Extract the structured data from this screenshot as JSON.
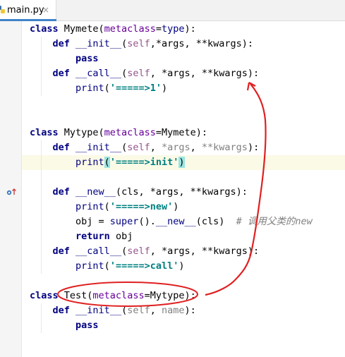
{
  "tab": {
    "filename": "main.py",
    "close": "×",
    "icon": "python-file-icon"
  },
  "code_lines": [
    {
      "parts": [
        [
          "kw",
          "class"
        ],
        [
          "",
          ""
        ],
        [
          "",
          " Mymete("
        ],
        [
          "kwarg",
          "metaclass"
        ],
        [
          "",
          "="
        ],
        [
          "bi",
          "type"
        ],
        [
          "",
          "):"
        ]
      ]
    },
    {
      "parts": [
        [
          "",
          "    "
        ],
        [
          "kw",
          "def"
        ],
        [
          "",
          " "
        ],
        [
          "bi",
          "__init__"
        ],
        [
          "",
          "("
        ],
        [
          "sf",
          "self"
        ],
        [
          "",
          ",*args, **kwargs):"
        ]
      ]
    },
    {
      "parts": [
        [
          "",
          "        "
        ],
        [
          "kw",
          "pass"
        ]
      ]
    },
    {
      "parts": [
        [
          "",
          "    "
        ],
        [
          "kw",
          "def"
        ],
        [
          "",
          " "
        ],
        [
          "bi",
          "__call__"
        ],
        [
          "",
          "("
        ],
        [
          "sf",
          "self"
        ],
        [
          "",
          ", *args, **kwargs):"
        ]
      ]
    },
    {
      "parts": [
        [
          "",
          "        "
        ],
        [
          "bi",
          "print"
        ],
        [
          "",
          "("
        ],
        [
          "st",
          "'=====>1'"
        ],
        [
          "",
          ")"
        ]
      ]
    },
    {
      "parts": []
    },
    {
      "parts": []
    },
    {
      "parts": [
        [
          "kw",
          "class"
        ],
        [
          "",
          " Mytype("
        ],
        [
          "kwarg",
          "metaclass"
        ],
        [
          "",
          "=Mymete):"
        ]
      ]
    },
    {
      "parts": [
        [
          "",
          "    "
        ],
        [
          "kw",
          "def"
        ],
        [
          "",
          " "
        ],
        [
          "bi",
          "__init__"
        ],
        [
          "",
          "("
        ],
        [
          "sf",
          "self"
        ],
        [
          "",
          ", "
        ],
        [
          "unused",
          "*args"
        ],
        [
          "",
          ", "
        ],
        [
          "unused",
          "**kwargs"
        ],
        [
          "",
          "):"
        ]
      ]
    },
    {
      "parts": [
        [
          "",
          "        "
        ],
        [
          "bi",
          "print"
        ],
        [
          "bm",
          "("
        ],
        [
          "st",
          "'=====>init'"
        ],
        [
          "bm",
          ")"
        ]
      ]
    },
    {
      "parts": []
    },
    {
      "parts": [
        [
          "",
          "    "
        ],
        [
          "kw",
          "def"
        ],
        [
          "",
          " "
        ],
        [
          "bi",
          "__new__"
        ],
        [
          "",
          "(cls, *args, **kwargs):"
        ]
      ]
    },
    {
      "parts": [
        [
          "",
          "        "
        ],
        [
          "bi",
          "print"
        ],
        [
          "",
          "("
        ],
        [
          "st",
          "'=====>new'"
        ],
        [
          "",
          ")"
        ]
      ]
    },
    {
      "parts": [
        [
          "",
          "        obj = "
        ],
        [
          "bi",
          "super"
        ],
        [
          "",
          "()."
        ],
        [
          "bi",
          "__new__"
        ],
        [
          "",
          "(cls)  "
        ],
        [
          "cm",
          "# 调用父类的new"
        ]
      ]
    },
    {
      "parts": [
        [
          "",
          "        "
        ],
        [
          "kw",
          "return"
        ],
        [
          "",
          " obj"
        ]
      ]
    },
    {
      "parts": [
        [
          "",
          "    "
        ],
        [
          "kw",
          "def"
        ],
        [
          "",
          " "
        ],
        [
          "bi",
          "__call__"
        ],
        [
          "",
          "("
        ],
        [
          "sf",
          "self"
        ],
        [
          "",
          ", *args, **kwargs):"
        ]
      ]
    },
    {
      "parts": [
        [
          "",
          "        "
        ],
        [
          "bi",
          "print"
        ],
        [
          "",
          "("
        ],
        [
          "st",
          "'=====>call'"
        ],
        [
          "",
          ")"
        ]
      ]
    },
    {
      "parts": []
    },
    {
      "parts": [
        [
          "kw",
          "class"
        ],
        [
          "",
          " Test("
        ],
        [
          "kwarg",
          "metaclass"
        ],
        [
          "",
          "=Mytype):"
        ]
      ]
    },
    {
      "parts": [
        [
          "",
          "    "
        ],
        [
          "kw",
          "def"
        ],
        [
          "",
          " "
        ],
        [
          "bi",
          "__init__"
        ],
        [
          "",
          "("
        ],
        [
          "unused",
          "self"
        ],
        [
          "",
          ", "
        ],
        [
          "unused",
          "name"
        ],
        [
          "",
          "):"
        ]
      ]
    },
    {
      "parts": [
        [
          "",
          "        "
        ],
        [
          "kw",
          "pass"
        ]
      ]
    }
  ],
  "gutter_icon": "override-method-icon",
  "annotation": {
    "arrow": "red-arrow",
    "ellipse": "red-ellipse",
    "color": "#e02020"
  },
  "colors": {
    "keyword": "#000080",
    "self": "#94558d",
    "string": "#008080",
    "kwarg": "#660099",
    "comment": "#808080",
    "highlight": "#fbfae6",
    "brace_match": "#99e5e2"
  }
}
